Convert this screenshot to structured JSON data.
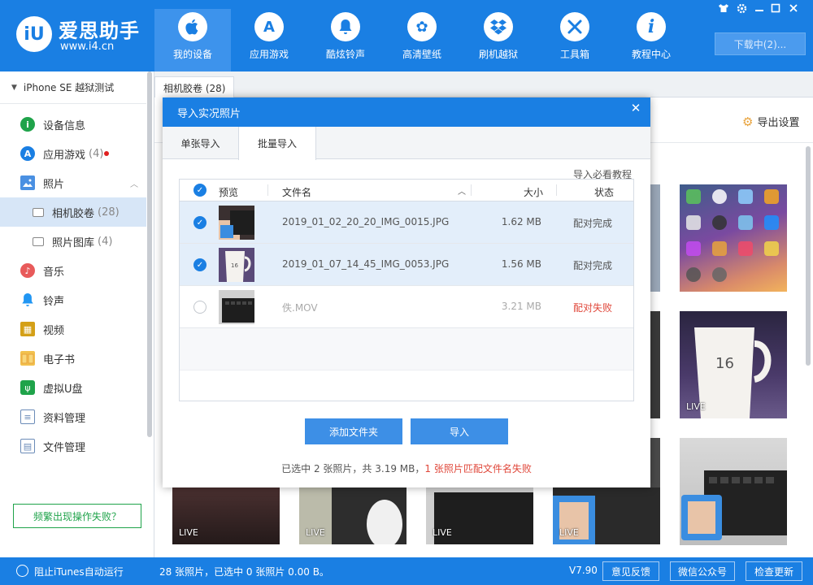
{
  "app": {
    "logo_text": "iU",
    "brand_name": "爱思助手",
    "brand_url": "www.i4.cn"
  },
  "nav": [
    {
      "label": "我的设备",
      "icon": "apple-icon",
      "glyph": ""
    },
    {
      "label": "应用游戏",
      "icon": "app-store-icon",
      "glyph": "A"
    },
    {
      "label": "酷炫铃声",
      "icon": "bell-icon",
      "glyph": "♪"
    },
    {
      "label": "高清壁纸",
      "icon": "flower-icon",
      "glyph": "✿"
    },
    {
      "label": "刷机越狱",
      "icon": "dropbox-icon",
      "glyph": "◈"
    },
    {
      "label": "工具箱",
      "icon": "tools-icon",
      "glyph": "✕"
    },
    {
      "label": "教程中心",
      "icon": "info-icon",
      "glyph": "i"
    }
  ],
  "window_controls": [
    "shirt-icon",
    "settings-icon",
    "minimize-icon",
    "maximize-icon",
    "close-icon"
  ],
  "download_button": "下载中(2)...",
  "sidebar": {
    "device_name": "iPhone SE 越狱测试",
    "items": [
      {
        "label": "设备信息",
        "icon": "info-circle-icon",
        "color": "#1fa34a"
      },
      {
        "label": "应用游戏",
        "count": "(4)",
        "icon": "app-store-icon",
        "color": "#1a7fe3",
        "badge": true
      },
      {
        "label": "照片",
        "icon": "photo-icon",
        "color": "#4a90e2"
      },
      {
        "label": "相机胶卷",
        "count": "(28)",
        "icon": "folder-icon",
        "sub": true,
        "selected": true
      },
      {
        "label": "照片图库",
        "count": "(4)",
        "icon": "folder-icon",
        "sub": true
      },
      {
        "label": "音乐",
        "icon": "music-icon",
        "color": "#e85a5a"
      },
      {
        "label": "铃声",
        "icon": "bell-icon",
        "color": "#2196f3"
      },
      {
        "label": "视频",
        "icon": "video-icon",
        "color": "#d4a017"
      },
      {
        "label": "电子书",
        "icon": "book-icon",
        "color": "#e8a33d"
      },
      {
        "label": "虚拟U盘",
        "icon": "usb-icon",
        "color": "#1fa34a"
      },
      {
        "label": "资料管理",
        "icon": "contacts-icon",
        "color": "#6b8bb8"
      },
      {
        "label": "文件管理",
        "icon": "file-icon",
        "color": "#6b8bb8"
      }
    ],
    "faq_button": "频繁出现操作失败？"
  },
  "main": {
    "tab_label": "相机胶卷 (28)",
    "export_settings": "导出设置",
    "live_label": "LIVE"
  },
  "dialog": {
    "title": "导入实况照片",
    "tabs": [
      "单张导入",
      "批量导入"
    ],
    "guide_link": "导入必看教程",
    "columns": {
      "preview": "预览",
      "filename": "文件名",
      "size": "大小",
      "status": "状态"
    },
    "rows": [
      {
        "filename": "2019_01_02_20_20_IMG_0015.JPG",
        "size": "1.62 MB",
        "status": "配对完成",
        "checked": true
      },
      {
        "filename": "2019_01_07_14_45_IMG_0053.JPG",
        "size": "1.56 MB",
        "status": "配对完成",
        "checked": true
      },
      {
        "filename": "佚.MOV",
        "size": "3.21 MB",
        "status": "配对失败",
        "checked": false
      }
    ],
    "add_folder_button": "添加文件夹",
    "import_button": "导入",
    "summary_prefix": "已选中 2 张照片，共 3.19 MB，",
    "summary_error": "1 张照片匹配文件名失败"
  },
  "status_bar": {
    "itunes_label": "阻止iTunes自动运行",
    "status_text": "28 张照片，已选中 0 张照片 0.00 B。",
    "version": "V7.90",
    "buttons": [
      "意见反馈",
      "微信公众号",
      "检查更新"
    ]
  },
  "colors": {
    "accent": "#1a7fe3",
    "error": "#e0483b",
    "success": "#1fa34a"
  }
}
